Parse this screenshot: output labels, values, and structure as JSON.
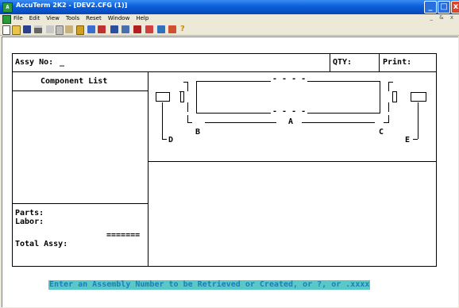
{
  "window": {
    "title": "AccuTerm 2K2 - [DEV2.CFG (1)]",
    "app_icon": "terminal-icon",
    "controls": {
      "minimize": "_",
      "maximize": "□",
      "close": "x"
    }
  },
  "menubar": {
    "items": [
      "File",
      "Edit",
      "View",
      "Tools",
      "Reset",
      "Window",
      "Help"
    ],
    "mdi_controls": "_ & x"
  },
  "toolbar": {
    "buttons": [
      "new-icon",
      "open-icon",
      "save-icon",
      "print-icon",
      "cut-icon",
      "copy-icon",
      "paste-icon",
      "macro-icon",
      "transfer-icon",
      "settings-icon",
      "screen-icon",
      "keyboard-icon",
      "capture-icon",
      "kermit-icon",
      "record-icon",
      "options-icon",
      "help-icon"
    ]
  },
  "form": {
    "assy_label": "Assy No:",
    "assy_value": "_",
    "qty_label": "QTY:",
    "print_label": "Print:",
    "component_list_header": "Component List",
    "parts_label": "Parts:",
    "labor_label": "Labor:",
    "separator": "=======",
    "total_label": "Total Assy:"
  },
  "diagram": {
    "label_a": "A",
    "label_b": "B",
    "label_c": "C",
    "label_d": "D",
    "label_e": "E",
    "dashes": "- - - -"
  },
  "status_message": "Enter an Assembly Number to be Retrieved or Created, or ?, or .xxxx",
  "colors": {
    "titlebar": "#0a5fd8",
    "status_bg": "#5bc8c8",
    "status_fg": "#1f7db8"
  }
}
